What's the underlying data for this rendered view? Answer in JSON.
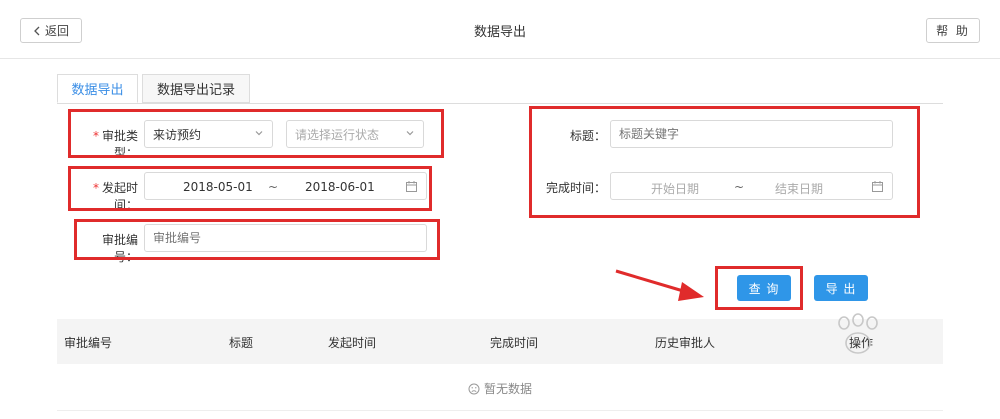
{
  "header": {
    "back_label": "返回",
    "title": "数据导出",
    "help_label": "帮 助"
  },
  "tabs": [
    {
      "label": "数据导出",
      "active": true
    },
    {
      "label": "数据导出记录",
      "active": false
    }
  ],
  "form": {
    "approval_type": {
      "label": "审批类型",
      "value": "来访预约",
      "status_placeholder": "请选择运行状态"
    },
    "start_time": {
      "label": "发起时间",
      "from": "2018-05-01",
      "sep": "~",
      "to": "2018-06-01"
    },
    "approval_no": {
      "label": "审批编号",
      "placeholder": "审批编号"
    },
    "title": {
      "label": "标题",
      "placeholder": "标题关键字"
    },
    "finish_time": {
      "label": "完成时间",
      "from_placeholder": "开始日期",
      "sep": "~",
      "to_placeholder": "结束日期"
    },
    "colon": "："
  },
  "actions": {
    "query_label": "查 询",
    "export_label": "导 出"
  },
  "table": {
    "columns": [
      "审批编号",
      "标题",
      "发起时间",
      "完成时间",
      "历史审批人",
      "操作"
    ],
    "empty_text": "暂无数据"
  },
  "colors": {
    "accent": "#2f96e8",
    "highlight": "#e02b2b"
  }
}
